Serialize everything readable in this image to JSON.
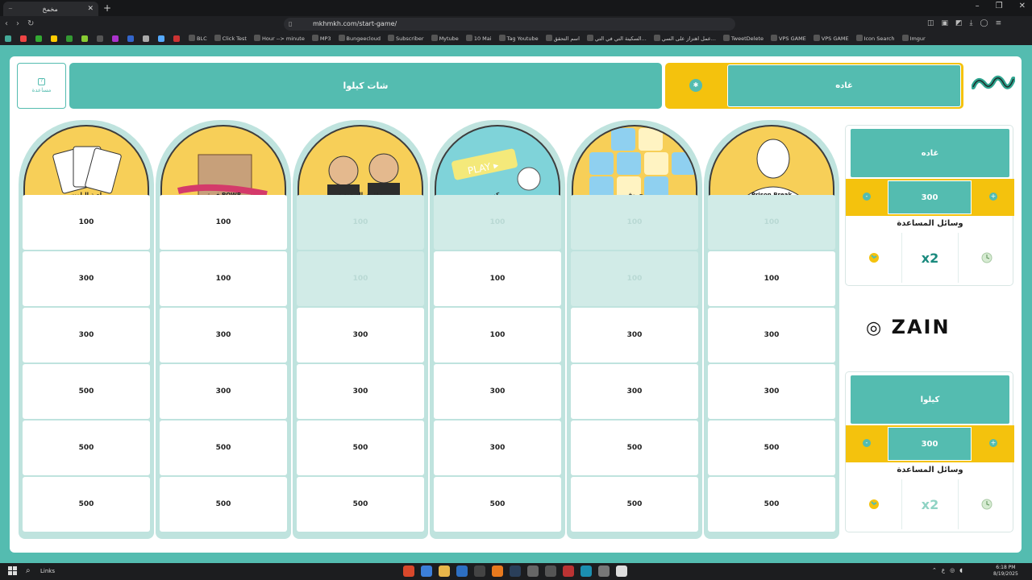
{
  "browser": {
    "tab_title": "مخمخ",
    "url": "mkhmkh.com/start-game/",
    "bookmarks": [
      "BLC",
      "Click Test",
      "Hour --> minute",
      "MP3",
      "Bungeecloud",
      "Subscriber",
      "Mytube",
      "10 Mai",
      "Tag Youtube",
      "اسم التحقق",
      "السكينة التي في التي...",
      "عمل اهتزاز على السي...",
      "TweetDelete",
      "VPS GAME",
      "VPS GAME",
      "Icon Search",
      "Imgur"
    ]
  },
  "header": {
    "help_button": "مساعدة",
    "team_bar": "شات كيلوا",
    "current_turn_team": "غاده"
  },
  "board": {
    "categories": [
      "لعبة البلوت",
      "فريق POWR",
      "مؤثري السعودية",
      "ركز",
      "حروف",
      "Prison Break"
    ],
    "columns": [
      [
        {
          "v": "100",
          "used": false
        },
        {
          "v": "300",
          "used": false
        },
        {
          "v": "300",
          "used": false
        },
        {
          "v": "500",
          "used": false
        },
        {
          "v": "500",
          "used": false
        },
        {
          "v": "500",
          "used": false
        }
      ],
      [
        {
          "v": "100",
          "used": false
        },
        {
          "v": "100",
          "used": false
        },
        {
          "v": "300",
          "used": false
        },
        {
          "v": "300",
          "used": false
        },
        {
          "v": "500",
          "used": false
        },
        {
          "v": "500",
          "used": false
        }
      ],
      [
        {
          "v": "100",
          "used": true
        },
        {
          "v": "100",
          "used": true
        },
        {
          "v": "300",
          "used": false
        },
        {
          "v": "300",
          "used": false
        },
        {
          "v": "500",
          "used": false
        },
        {
          "v": "500",
          "used": false
        }
      ],
      [
        {
          "v": "100",
          "used": true
        },
        {
          "v": "100",
          "used": false
        },
        {
          "v": "100",
          "used": false
        },
        {
          "v": "300",
          "used": false
        },
        {
          "v": "300",
          "used": false
        },
        {
          "v": "500",
          "used": false
        }
      ],
      [
        {
          "v": "100",
          "used": true
        },
        {
          "v": "100",
          "used": true
        },
        {
          "v": "300",
          "used": false
        },
        {
          "v": "300",
          "used": false
        },
        {
          "v": "500",
          "used": false
        },
        {
          "v": "500",
          "used": false
        }
      ],
      [
        {
          "v": "100",
          "used": true
        },
        {
          "v": "100",
          "used": false
        },
        {
          "v": "300",
          "used": false
        },
        {
          "v": "300",
          "used": false
        },
        {
          "v": "500",
          "used": false
        },
        {
          "v": "500",
          "used": false
        }
      ]
    ]
  },
  "teams": [
    {
      "name": "غاده",
      "score": "300",
      "plus": "+",
      "minus": "-",
      "help_title": "وسائل المساعدة",
      "aid_double": "x2"
    },
    {
      "name": "كيلوا",
      "score": "300",
      "plus": "+",
      "minus": "-",
      "help_title": "وسائل المساعدة",
      "aid_double": "x2"
    }
  ],
  "sponsor": "ZAIN",
  "taskbar": {
    "search_label": "Links",
    "time": "6:18 PM",
    "date": "8/19/2025"
  },
  "colors": {
    "teal": "#54bcb0",
    "yellow": "#f4c20d",
    "used_cell": "#d1ebe7"
  }
}
